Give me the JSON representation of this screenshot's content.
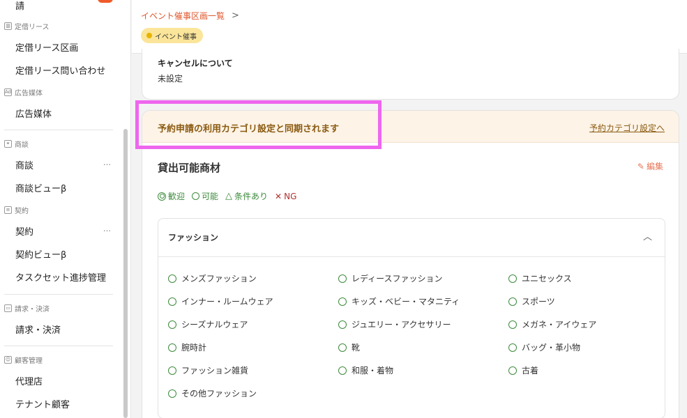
{
  "sidebar": {
    "top_item": "請",
    "sections": [
      {
        "label": "定借リース",
        "icon": "building-icon",
        "items": [
          "定借リース区画",
          "定借リース問い合わせ"
        ]
      },
      {
        "label": "広告媒体",
        "icon": "ad-icon",
        "items": [
          "広告媒体"
        ]
      },
      {
        "label": "商談",
        "icon": "handshake-icon",
        "items": [
          "商談",
          "商談ビューβ"
        ]
      },
      {
        "label": "契約",
        "icon": "document-icon",
        "items": [
          "契約",
          "契約ビューβ",
          "タスクセット進捗管理"
        ]
      },
      {
        "label": "請求・決済",
        "icon": "card-icon",
        "items": [
          "請求・決済"
        ]
      },
      {
        "label": "顧客管理",
        "icon": "users-icon",
        "items": [
          "代理店",
          "テナント顧客"
        ]
      }
    ],
    "more_label": "…"
  },
  "header": {
    "breadcrumb": "イベント催事区画一覧",
    "breadcrumb_sep": ">",
    "tag": "イベント催事"
  },
  "cancel": {
    "title": "キャンセルについて",
    "value": "未設定"
  },
  "sync": {
    "text": "予約申請の利用カテゴリ設定と同期されます",
    "link": "予約カテゴリ設定へ"
  },
  "section": {
    "title": "貸出可能商材",
    "edit_label": "編集"
  },
  "legend": {
    "welcome": "歓迎",
    "possible": "可能",
    "conditional": "条件あり",
    "ng": "NG"
  },
  "category": {
    "title": "ファッション",
    "items": [
      "メンズファッション",
      "レディースファッション",
      "ユニセックス",
      "インナー・ルームウェア",
      "キッズ・ベビー・マタニティ",
      "スポーツ",
      "シーズナルウェア",
      "ジュエリー・アクセサリー",
      "メガネ・アイウェア",
      "腕時計",
      "靴",
      "バッグ・革小物",
      "ファッション雑貨",
      "和服・着物",
      "古着",
      "その他ファッション"
    ]
  },
  "colors": {
    "accent": "#e0562b",
    "green": "#3d8b3d",
    "ng_red": "#b03030",
    "highlight": "#ee66ee",
    "tag_bg": "#fbe59a"
  }
}
